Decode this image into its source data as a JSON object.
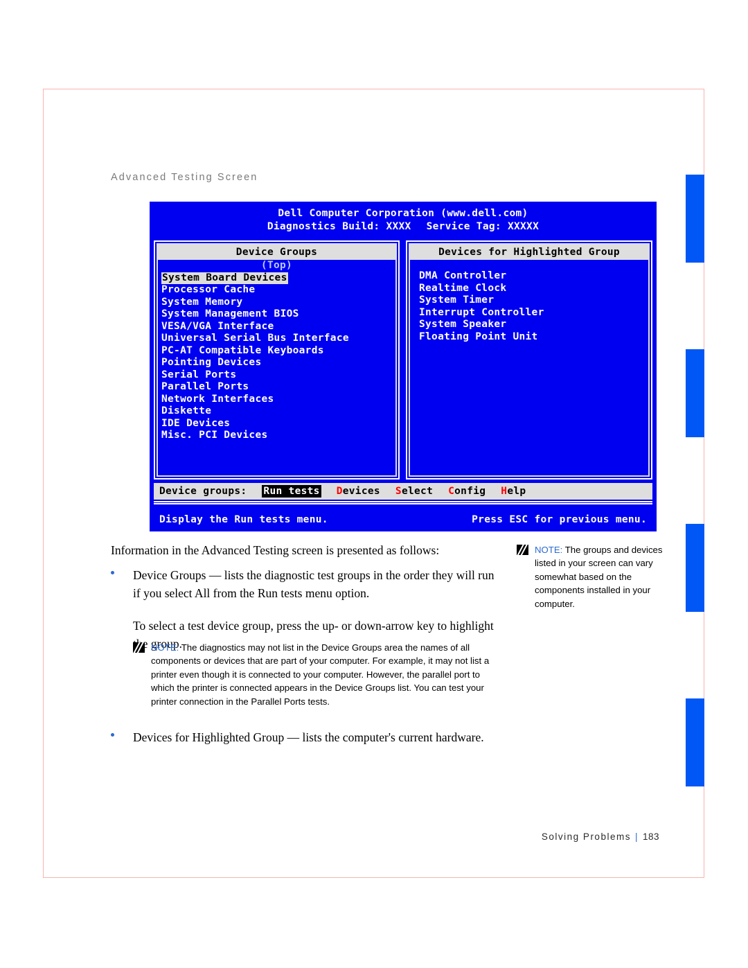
{
  "page": {
    "section_heading": "Advanced Testing Screen",
    "footer_chapter": "Solving Problems",
    "footer_separator": "|",
    "footer_page": "183",
    "accent_blue": "#0057f5",
    "border_pink": "#f8b4b0",
    "note_keyword_blue": "#2b6ad0"
  },
  "bios_screen": {
    "title_line1": "Dell Computer Corporation (www.dell.com)",
    "title_line2_a": "Diagnostics Build: XXXX",
    "title_line2_b": "Service Tag: XXXXX",
    "background": "#0000f0",
    "left_panel": {
      "header": "Device Groups",
      "top_marker": "(Top)",
      "selected_index": 0,
      "items": [
        "System Board Devices",
        "Processor Cache",
        "System Memory",
        "System Management BIOS",
        "VESA/VGA Interface",
        "Universal Serial Bus Interface",
        "PC-AT Compatible Keyboards",
        "Pointing Devices",
        "Serial Ports",
        "Parallel Ports",
        "Network Interfaces",
        "Diskette",
        "IDE Devices",
        "Misc. PCI Devices"
      ]
    },
    "right_panel": {
      "header": "Devices for Highlighted Group",
      "items": [
        "DMA Controller",
        "Realtime Clock",
        "System Timer",
        "Interrupt Controller",
        "System Speaker",
        "Floating Point Unit"
      ]
    },
    "menubar": {
      "label": "Device groups:",
      "items": [
        {
          "text": "Run tests",
          "hotkey": "",
          "active": true
        },
        {
          "text": "Devices",
          "hotkey": "D",
          "active": false
        },
        {
          "text": "Select",
          "hotkey": "S",
          "active": false
        },
        {
          "text": "Config",
          "hotkey": "C",
          "active": false
        },
        {
          "text": "Help",
          "hotkey": "H",
          "active": false
        }
      ]
    },
    "status": {
      "left": "Display the Run tests menu.",
      "right": "Press ESC for previous menu."
    }
  },
  "content": {
    "intro": "Information in the Advanced Testing screen is presented as follows:",
    "bullet_1_para_1": "Device Groups — lists the diagnostic test groups in the order they will run if you select All from the Run tests menu option.",
    "bullet_1_para_2": "To select a test device group, press the up- or down-arrow key to highlight the group.",
    "bullet_2_para_1": "Devices for Highlighted Group — lists the computer's current hardware."
  },
  "notes": {
    "main": {
      "keyword": "NOTE:",
      "text": " The diagnostics may not list in the Device Groups area the names of all components or devices that are part of your computer. For example, it may not list a printer even though it is connected to your computer. However, the parallel port to which the printer is connected appears in the Device Groups list. You can test your printer connection in the Parallel Ports tests."
    },
    "side": {
      "keyword": "NOTE:",
      "text": " The groups and devices listed in your screen can vary somewhat based on the components installed in your computer."
    }
  }
}
